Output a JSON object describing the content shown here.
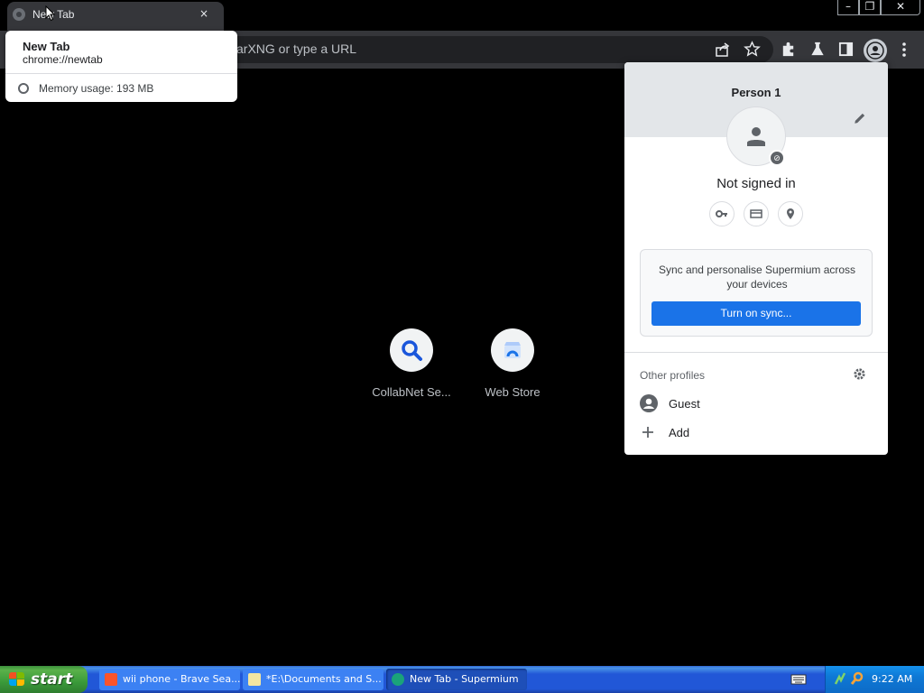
{
  "browser": {
    "tab": {
      "title": "New Tab",
      "close_glyph": "×"
    },
    "window_controls": {
      "minimize": "–",
      "maximize": "❐",
      "close": "✕"
    },
    "omnibox": {
      "text": "arXNG or type a URL"
    },
    "hover_card": {
      "title": "New Tab",
      "url": "chrome://newtab",
      "memory": "Memory usage: 193 MB"
    },
    "toolbar_icons": [
      "share-icon",
      "bookmark-star-icon",
      "extensions-icon",
      "labs-flask-icon",
      "side-panel-icon",
      "profile-icon",
      "menu-icon"
    ]
  },
  "shortcuts": [
    {
      "label": "CollabNet Se...",
      "icon": "search-magnifier-icon"
    },
    {
      "label": "Web Store",
      "icon": "web-store-icon"
    }
  ],
  "profile_panel": {
    "name": "Person 1",
    "status": "Not signed in",
    "quick_actions": [
      "password-key-icon",
      "payment-card-icon",
      "address-pin-icon"
    ],
    "sync": {
      "text": "Sync and personalise Supermium across your devices",
      "button": "Turn on sync..."
    },
    "other_profiles": {
      "heading": "Other profiles",
      "guest": "Guest",
      "add": "Add"
    },
    "colors": {
      "sync_button": "#1a73e8",
      "header": "#e3e6e9"
    }
  },
  "taskbar": {
    "start": "start",
    "tasks": [
      {
        "label": "wii phone - Brave Sea...",
        "active": false
      },
      {
        "label": "*E:\\Documents and S...",
        "active": false
      },
      {
        "label": "New Tab - Supermium",
        "active": true
      }
    ],
    "clock": "9:22 AM"
  }
}
